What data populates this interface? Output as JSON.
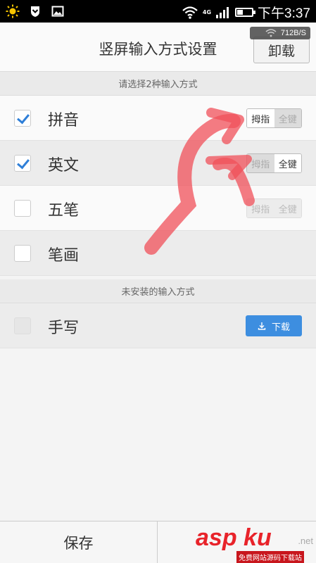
{
  "status_bar": {
    "network": "4G",
    "time": "下午3:37",
    "speed": "712B/S"
  },
  "header": {
    "title": "竖屏输入方式设置",
    "uninstall_label": "卸载"
  },
  "installed_section": {
    "title": "请选择2种输入方式",
    "rows": [
      {
        "label": "拼音",
        "checked": true,
        "options": [
          "拇指",
          "全键"
        ],
        "selected": "拇指"
      },
      {
        "label": "英文",
        "checked": true,
        "options": [
          "拇指",
          "全键"
        ],
        "selected": "全键"
      },
      {
        "label": "五笔",
        "checked": false,
        "options": [
          "拇指",
          "全键"
        ],
        "selected": ""
      },
      {
        "label": "笔画",
        "checked": false
      }
    ]
  },
  "uninstalled_section": {
    "title": "未安装的输入方式",
    "rows": [
      {
        "label": "手写",
        "checked": false,
        "download_label": "下载"
      }
    ]
  },
  "footer": {
    "save_label": "保存"
  },
  "watermark": {
    "brand": "asp ku",
    "domain": ".net",
    "tagline": "免费网站源码下载站"
  },
  "colors": {
    "accent": "#3d8ee0",
    "check": "#2f7fd8",
    "annotation": "#f0505a",
    "watermark": "#e8232a"
  }
}
